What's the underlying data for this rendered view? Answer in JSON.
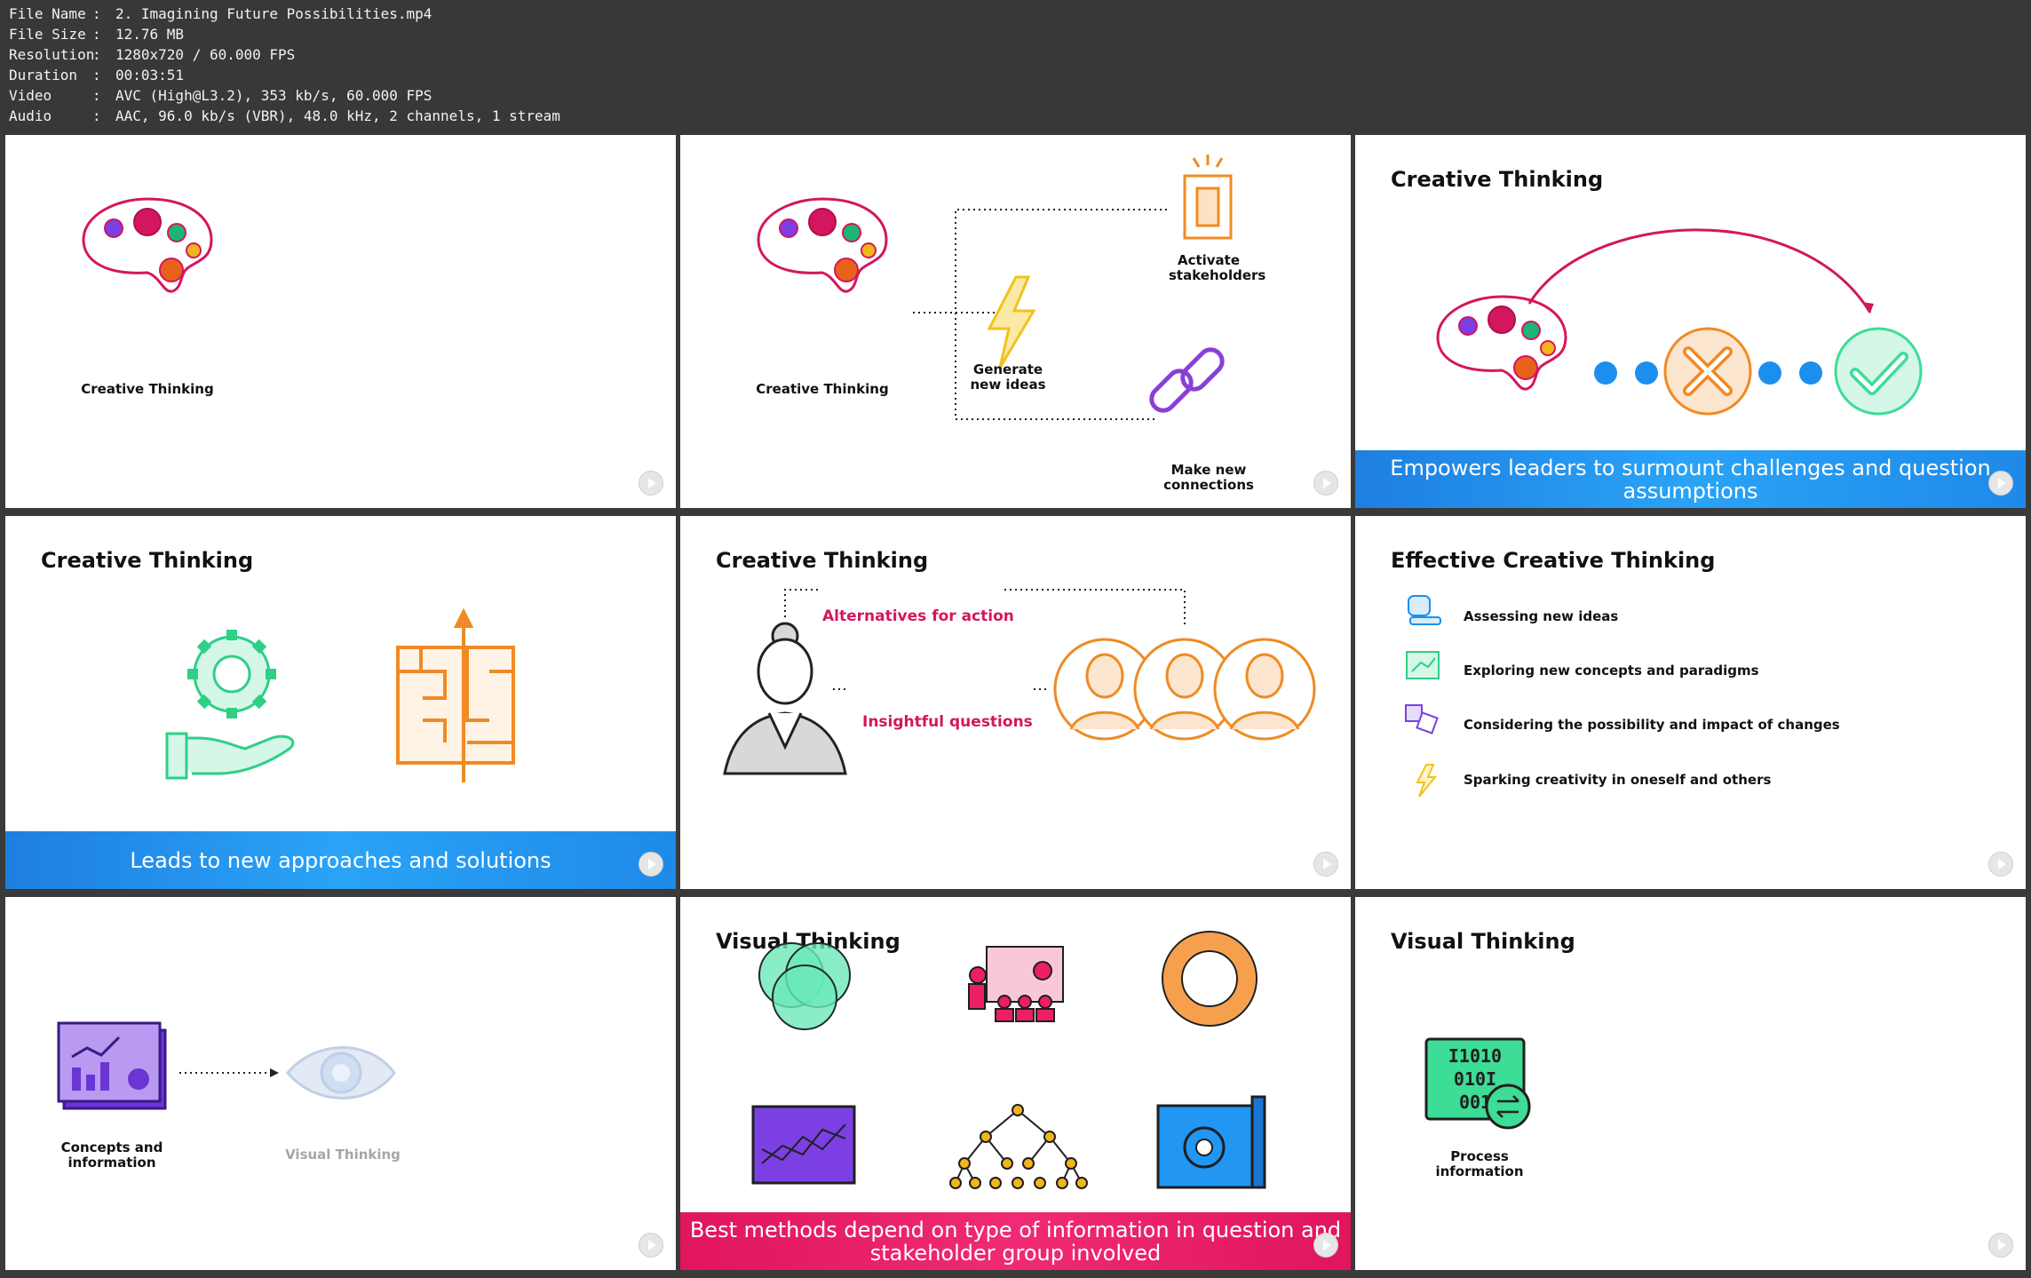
{
  "meta": {
    "rows": [
      {
        "key": "File Name",
        "value": "2. Imagining Future Possibilities.mp4"
      },
      {
        "key": "File Size",
        "value": "12.76 MB"
      },
      {
        "key": "Resolution",
        "value": "1280x720 / 60.000 FPS"
      },
      {
        "key": "Duration",
        "value": "00:03:51"
      },
      {
        "key": "Video",
        "value": "AVC (High@L3.2), 353 kb/s, 60.000 FPS"
      },
      {
        "key": "Audio",
        "value": "AAC, 96.0 kb/s (VBR), 48.0 kHz, 2 channels, 1 stream"
      }
    ]
  },
  "panels": {
    "p1": {
      "label": "Creative Thinking"
    },
    "p2": {
      "label": "Creative Thinking",
      "activate": "Activate stakeholders",
      "generate": "Generate new ideas",
      "connect": "Make new connections"
    },
    "p3": {
      "title": "Creative Thinking",
      "banner": "Empowers leaders to surmount challenges and question assumptions"
    },
    "p4": {
      "title": "Creative Thinking",
      "banner": "Leads to new approaches and solutions"
    },
    "p5": {
      "title": "Creative Thinking",
      "alternatives": "Alternatives for action",
      "questions": "Insightful questions"
    },
    "p6": {
      "title": "Effective Creative Thinking",
      "items": [
        "Assessing new ideas",
        "Exploring new concepts and paradigms",
        "Considering the possibility and impact of changes",
        "Sparking creativity in oneself and others"
      ]
    },
    "p7": {
      "concepts": "Concepts and information",
      "visual": "Visual Thinking"
    },
    "p8": {
      "title": "Visual Thinking",
      "banner": "Best methods depend on type of information in question and stakeholder group involved"
    },
    "p9": {
      "title": "Visual Thinking",
      "process": "Process information"
    }
  },
  "colors": {
    "accent_pink": "#d4165e",
    "banner_blue": "#2196f3",
    "banner_pink": "#ec1e66",
    "orange": "#f08a24",
    "green": "#3ddc97",
    "purple": "#7b3fe4"
  }
}
